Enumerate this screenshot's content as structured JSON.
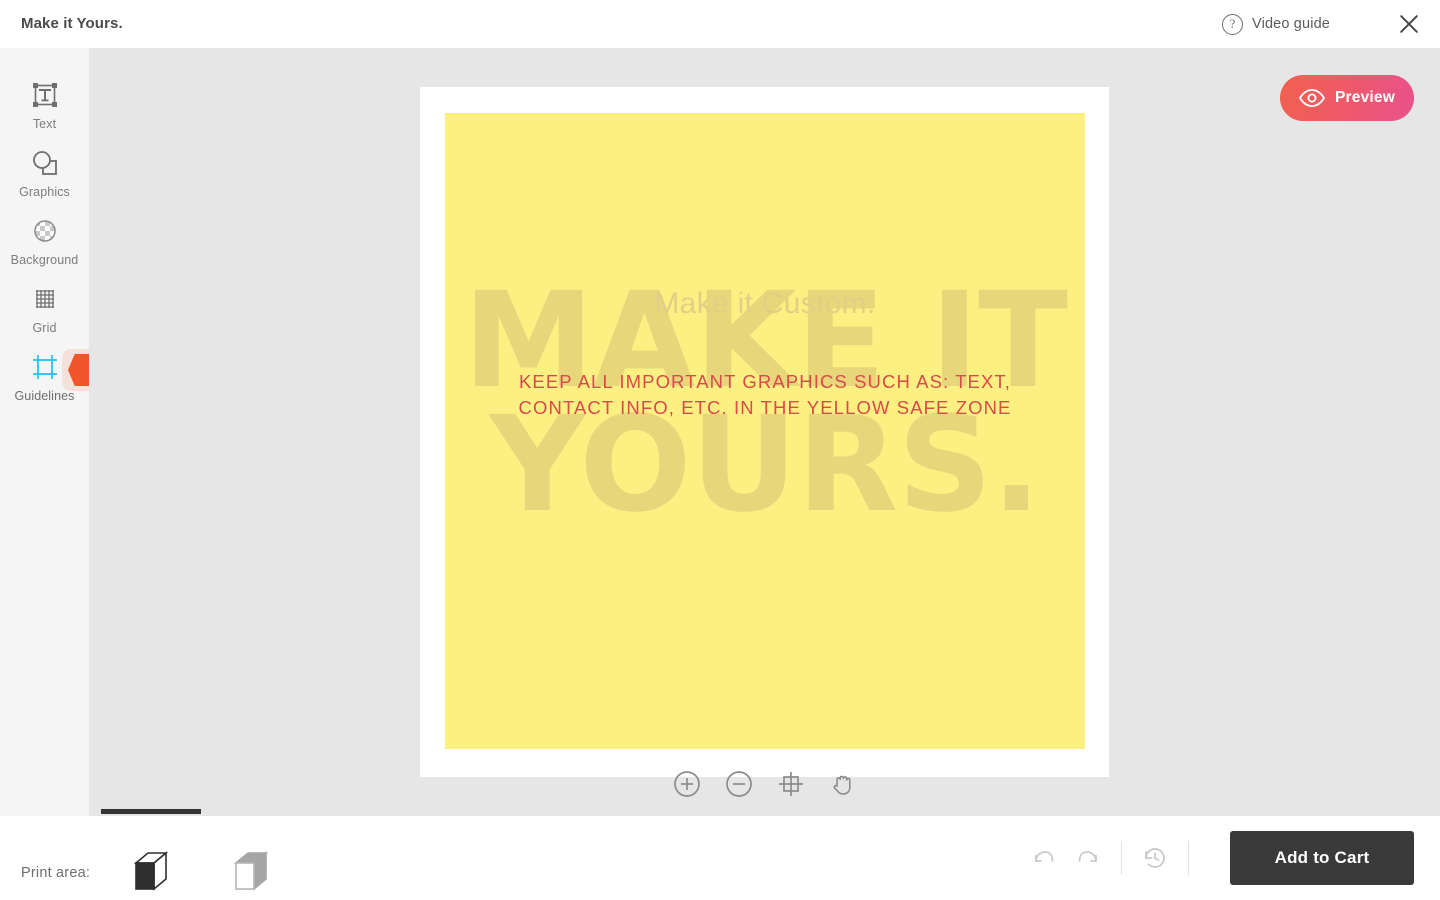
{
  "header": {
    "title": "Make it Yours.",
    "video_guide_label": "Video guide",
    "help_icon": "question-mark-circle-icon",
    "close_icon": "close-icon"
  },
  "sidebar": {
    "items": [
      {
        "label": "Text",
        "icon": "text-box-icon",
        "active": false
      },
      {
        "label": "Graphics",
        "icon": "shapes-icon",
        "active": false
      },
      {
        "label": "Background",
        "icon": "checker-circle-icon",
        "active": false
      },
      {
        "label": "Grid",
        "icon": "grid-icon",
        "active": false
      },
      {
        "label": "Guidelines",
        "icon": "guidelines-frame-icon",
        "active": true
      }
    ],
    "warning_badge": {
      "mark": "!",
      "color": "#f1562a"
    }
  },
  "canvas": {
    "preview_button": {
      "label": "Preview",
      "icon": "eye-icon"
    },
    "design": {
      "watermark_text": "MAKE IT\nYOURS.",
      "heading": "Make it Custom.",
      "safe_zone_message": "KEEP ALL IMPORTANT GRAPHICS SUCH AS: TEXT, CONTACT INFO, ETC. IN THE YELLOW SAFE ZONE",
      "safe_zone_color": "#fdf083",
      "message_color": "#d94a4a"
    },
    "zoom_controls": [
      {
        "name": "zoom-in",
        "icon": "plus-circle-icon"
      },
      {
        "name": "zoom-out",
        "icon": "minus-circle-icon"
      },
      {
        "name": "fit-to-screen",
        "icon": "crosshair-frame-icon"
      },
      {
        "name": "pan",
        "icon": "hand-icon"
      }
    ]
  },
  "footer": {
    "print_area_label": "Print area:",
    "areas": [
      {
        "name": "front",
        "icon": "cube-front-icon",
        "selected": true
      },
      {
        "name": "back",
        "icon": "cube-top-icon",
        "selected": false
      }
    ],
    "undo_icon": "undo-arrow-icon",
    "redo_icon": "redo-arrow-icon",
    "history_icon": "history-clock-icon",
    "add_to_cart_label": "Add to Cart"
  }
}
